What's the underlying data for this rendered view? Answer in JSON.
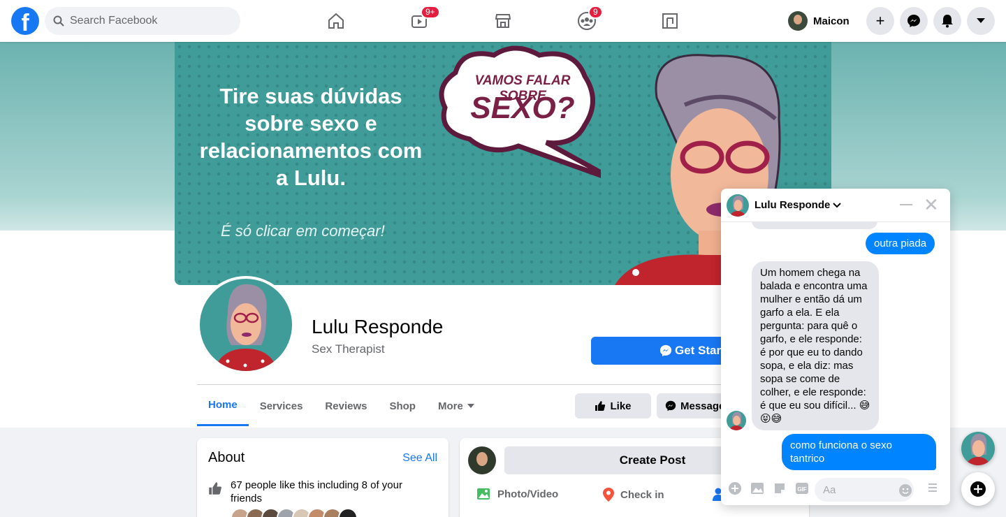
{
  "topbar": {
    "search_placeholder": "Search Facebook",
    "watch_badge": "9+",
    "groups_badge": "9",
    "user_name": "Maicon"
  },
  "cover": {
    "headline": "Tire suas dúvidas sobre sexo e relacionamentos com a Lulu.",
    "subline": "É só clicar em começar!",
    "bubble_line1": "VAMOS FALAR SOBRE",
    "bubble_line2": "SEXO?"
  },
  "page": {
    "name": "Lulu Responde",
    "category": "Sex Therapist",
    "get_started_label": "Get Started",
    "like_label": "Like",
    "message_label": "Message"
  },
  "tabs": [
    {
      "label": "Home"
    },
    {
      "label": "Services"
    },
    {
      "label": "Reviews"
    },
    {
      "label": "Shop"
    },
    {
      "label": "More"
    }
  ],
  "about": {
    "title": "About",
    "see_all": "See All",
    "likes_text": "67 people like this including 8 of your friends"
  },
  "composer": {
    "create_post": "Create Post",
    "photo_video": "Photo/Video",
    "check_in": "Check in"
  },
  "chat": {
    "name": "Lulu Responde",
    "input_placeholder": "Aa",
    "messages": [
      {
        "from": "me",
        "text": "outra piada"
      },
      {
        "from": "page",
        "text": "Um homem chega na balada e encontra uma mulher e então dá um garfo a ela. E ela pergunta: para quê o garfo, e ele responde: é por que eu to dando sopa, e ela diz: mas sopa se come de colher, e ele responde: é que eu sou difícil... 😅😝😅"
      },
      {
        "from": "me",
        "text": "como funciona o sexo tantrico"
      }
    ]
  },
  "colors": {
    "brand": "#1877f2",
    "messenger_blue": "#0084ff",
    "cover_teal": "#3f9c98",
    "badge_red": "#e41e3f"
  }
}
